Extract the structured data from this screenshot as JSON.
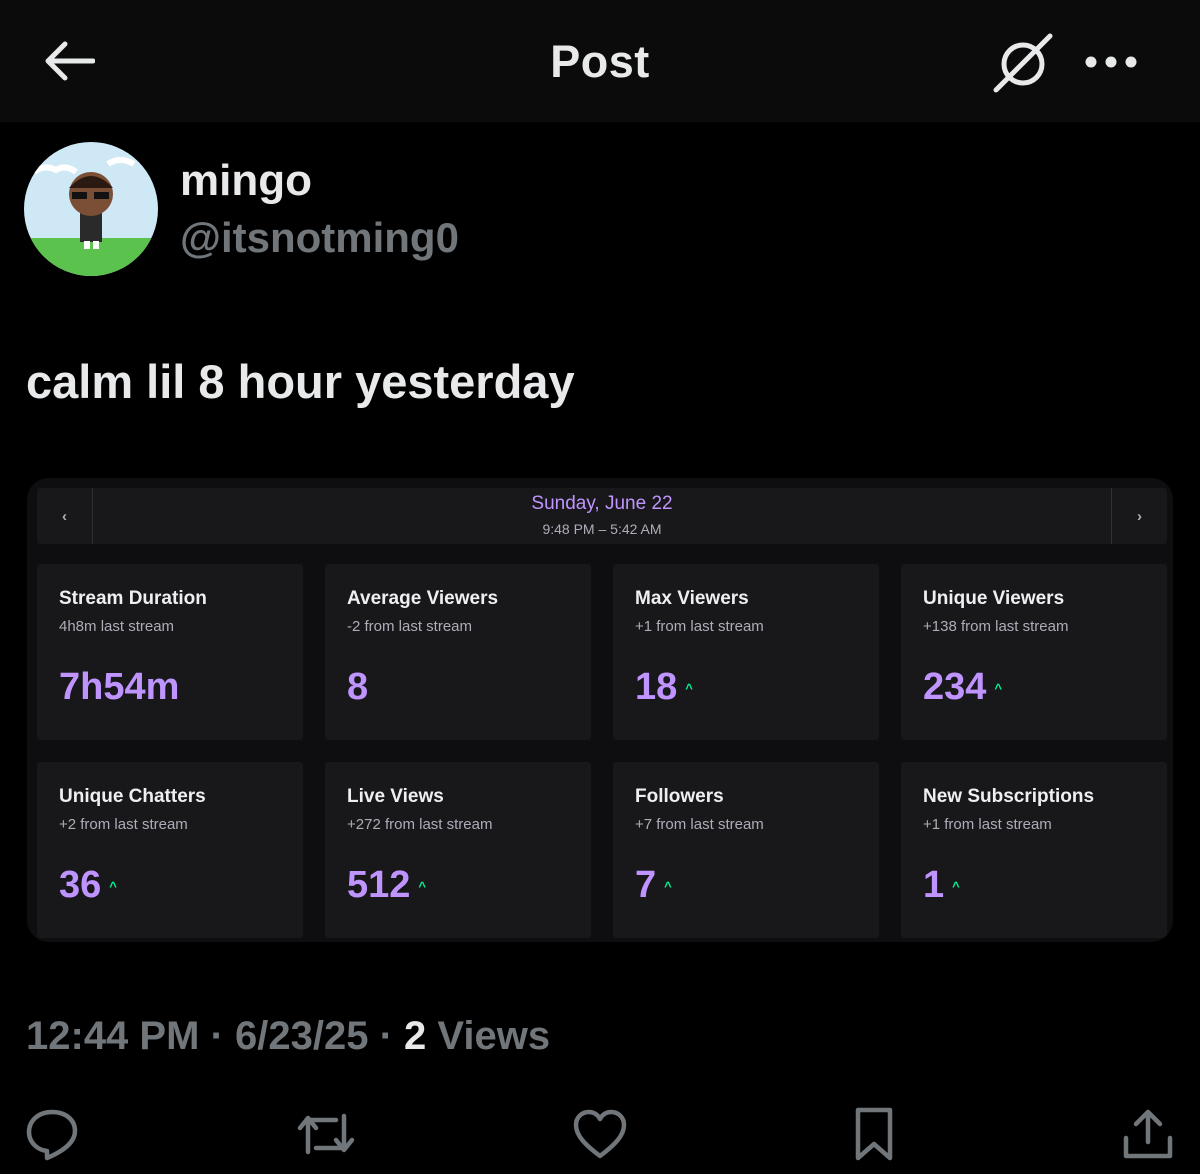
{
  "header": {
    "title": "Post",
    "back_icon": "back-arrow-icon",
    "grok_icon": "grok-icon",
    "more_icon": "more-icon"
  },
  "author": {
    "name": "mingo",
    "handle": "@itsnotming0"
  },
  "post": {
    "text": "calm lil 8 hour yesterday"
  },
  "media": {
    "date": "Sunday, June 22",
    "time_range": "9:48 PM – 5:42 AM",
    "prev_label": "‹",
    "next_label": "›",
    "accent_color": "#bf94ff",
    "up_color": "#00f593",
    "stats": [
      {
        "label": "Stream Duration",
        "sub": "4h8m last stream",
        "value": "7h54m",
        "trend": ""
      },
      {
        "label": "Average Viewers",
        "sub": "-2 from last stream",
        "value": "8",
        "trend": ""
      },
      {
        "label": "Max Viewers",
        "sub": "+1 from last stream",
        "value": "18",
        "trend": "^"
      },
      {
        "label": "Unique Viewers",
        "sub": "+138 from last stream",
        "value": "234",
        "trend": "^"
      },
      {
        "label": "Unique Chatters",
        "sub": "+2 from last stream",
        "value": "36",
        "trend": "^"
      },
      {
        "label": "Live Views",
        "sub": "+272 from last stream",
        "value": "512",
        "trend": "^"
      },
      {
        "label": "Followers",
        "sub": "+7 from last stream",
        "value": "7",
        "trend": "^"
      },
      {
        "label": "New Subscriptions",
        "sub": "+1 from last stream",
        "value": "1",
        "trend": "^"
      }
    ]
  },
  "meta": {
    "time": "12:44 PM",
    "separator": "·",
    "date": "6/23/25",
    "views_count": "2",
    "views_label": "Views"
  },
  "actions": [
    {
      "name": "reply-icon"
    },
    {
      "name": "repost-icon"
    },
    {
      "name": "like-icon"
    },
    {
      "name": "bookmark-icon"
    },
    {
      "name": "share-icon"
    }
  ]
}
